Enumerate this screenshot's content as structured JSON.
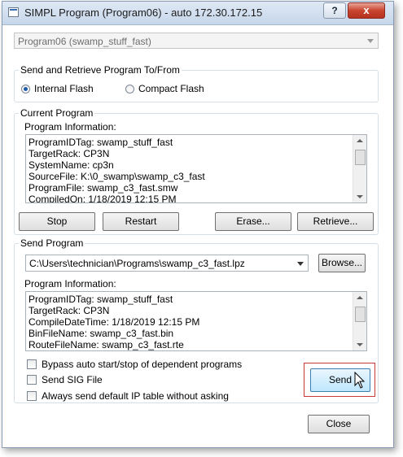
{
  "window": {
    "title": "SIMPL Program (Program06) - auto 172.30.172.15",
    "help_label": "?",
    "close_label": "x"
  },
  "program_select": {
    "value": "Program06 (swamp_stuff_fast)"
  },
  "send_retrieve": {
    "label": "Send and Retrieve Program To/From",
    "options": [
      {
        "label": "Internal Flash",
        "selected": true
      },
      {
        "label": "Compact Flash",
        "selected": false
      }
    ]
  },
  "current_program": {
    "label": "Current Program",
    "info_label": "Program Information:",
    "info_lines": [
      "ProgramIDTag: swamp_stuff_fast",
      "TargetRack: CP3N",
      "SystemName: cp3n",
      "SourceFile: K:\\0_swamp\\swamp_c3_fast",
      "ProgramFile: swamp_c3_fast.smw",
      "CompiledOn: 1/18/2019 12:15 PM"
    ],
    "buttons": {
      "stop": "Stop",
      "restart": "Restart",
      "erase": "Erase...",
      "retrieve": "Retrieve..."
    }
  },
  "send_program": {
    "label": "Send Program",
    "path_value": "C:\\Users\\technician\\Programs\\swamp_c3_fast.lpz",
    "browse_label": "Browse...",
    "info_label": "Program Information:",
    "info_lines": [
      "ProgramIDTag: swamp_stuff_fast",
      "TargetRack: CP3N",
      "CompileDateTime: 1/18/2019 12:15 PM",
      "BinFileName: swamp_c3_fast.bin",
      "RouteFileName: swamp_c3_fast.rte"
    ],
    "checkboxes": [
      {
        "label": "Bypass auto start/stop of dependent programs",
        "checked": false
      },
      {
        "label": "Send SIG File",
        "checked": false
      },
      {
        "label": "Always send default IP table without asking",
        "checked": false
      }
    ],
    "send_label": "Send"
  },
  "footer": {
    "close_label": "Close"
  },
  "colors": {
    "highlight": "#c83a3a",
    "title_bar": "#c6d6ea",
    "radio_dot": "#1f5aa8"
  }
}
